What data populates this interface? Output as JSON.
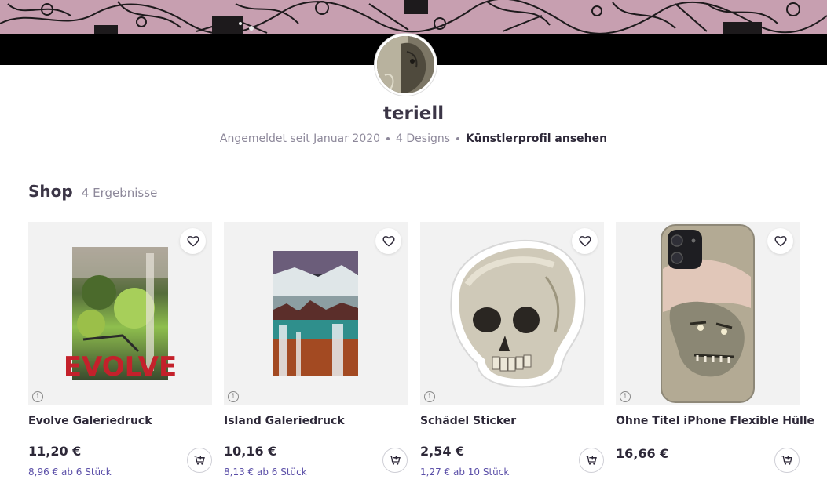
{
  "profile": {
    "username": "teriell",
    "member_since": "Angemeldet seit Januar 2020",
    "designs": "4 Designs",
    "artist_link": "Künstlerprofil ansehen"
  },
  "shop": {
    "title": "Shop",
    "count": "4 Ergebnisse"
  },
  "products": [
    {
      "name": "Evolve Galeriedruck",
      "price": "11,20 €",
      "bulk": "8,96 € ab 6 Stück",
      "art_text": "EVOLVE"
    },
    {
      "name": "Island Galeriedruck",
      "price": "10,16 €",
      "bulk": "8,13 € ab 6 Stück"
    },
    {
      "name": "Schädel Sticker",
      "price": "2,54 €",
      "bulk": "1,27 € ab 10 Stück"
    },
    {
      "name": "Ohne Titel iPhone Flexible Hülle",
      "price": "16,66 €",
      "bulk": ""
    }
  ],
  "icons": {
    "favorite": "heart-icon",
    "cart": "add-to-cart-icon",
    "info": "info-icon"
  },
  "colors": {
    "bulk_text": "#5b4fa8",
    "muted_text": "#8d889a",
    "heading": "#3b3546"
  }
}
